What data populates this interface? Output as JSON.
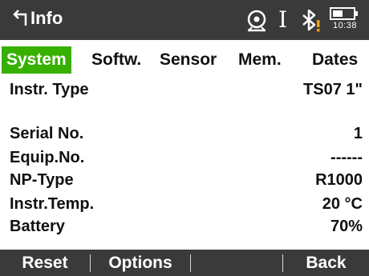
{
  "header": {
    "title": "Info",
    "back_icon": "back-arrow-icon",
    "status": {
      "icons": [
        "target-icon",
        "cursor-icon",
        "bluetooth-warning-icon",
        "battery-icon"
      ],
      "cursor_glyph": "I",
      "time": "10:38"
    }
  },
  "tabs": [
    {
      "label": "System",
      "active": true
    },
    {
      "label": "Softw.",
      "active": false
    },
    {
      "label": "Sensor",
      "active": false
    },
    {
      "label": "Mem.",
      "active": false
    },
    {
      "label": "Dates",
      "active": false
    }
  ],
  "rows": [
    {
      "label": "Instr. Type",
      "value": "TS07 1\""
    },
    {
      "label": "Serial No.",
      "value": "1"
    },
    {
      "label": "Equip.No.",
      "value": "------"
    },
    {
      "label": "NP-Type",
      "value": "R1000"
    },
    {
      "label": "Instr.Temp.",
      "value": "20 °C"
    },
    {
      "label": "Battery",
      "value": "70%"
    }
  ],
  "softkeys": [
    {
      "label": "Reset"
    },
    {
      "label": "Options"
    },
    {
      "label": ""
    },
    {
      "label": "Back"
    }
  ],
  "colors": {
    "bar_bg": "#3a3a3a",
    "tab_active": "#37b000",
    "warning": "#f0a000"
  }
}
